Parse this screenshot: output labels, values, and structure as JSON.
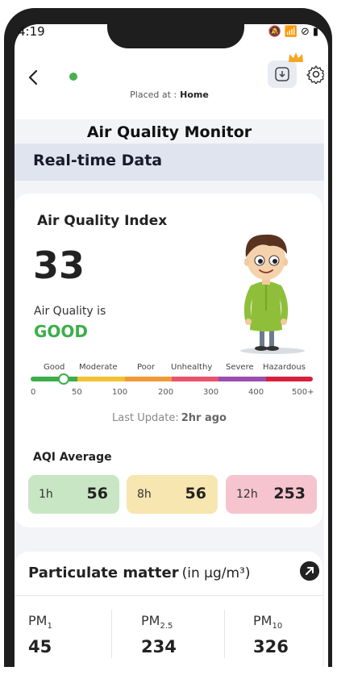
{
  "status_bar": {
    "time": "4:19"
  },
  "header": {
    "placed_at_label": "Placed at :",
    "placed_at_value": "Home",
    "online_color": "#4caf50"
  },
  "page_title": "Air Quality Monitor",
  "section_title": "Real-time Data",
  "aqi": {
    "title": "Air Quality Index",
    "value": "33",
    "quality_label": "Air Quality is",
    "quality_status": "GOOD",
    "marker_value": 33,
    "scale_labels": [
      "Good",
      "Moderate",
      "Poor",
      "Unhealthy",
      "Severe",
      "Hazardous"
    ],
    "scale_colors": [
      "#3cae4c",
      "#f2c232",
      "#f29a3a",
      "#e8536e",
      "#9b4db0",
      "#d6213b"
    ],
    "scale_numbers": [
      "0",
      "50",
      "100",
      "200",
      "300",
      "400",
      "500+"
    ],
    "last_update_label": "Last Update:",
    "last_update_value": "2hr ago"
  },
  "aqi_average": {
    "title": "AQI Average",
    "items": [
      {
        "label": "1h",
        "value": "56",
        "color": "#c8e6c3"
      },
      {
        "label": "8h",
        "value": "56",
        "color": "#f7e6b0"
      },
      {
        "label": "12h",
        "value": "253",
        "color": "#f5c4cf"
      }
    ]
  },
  "particulate": {
    "title": "Particulate matter",
    "unit": "(in µg/m³)",
    "items": [
      {
        "name": "PM",
        "sub": "1",
        "value": "45"
      },
      {
        "name": "PM",
        "sub": "2.5",
        "value": "234"
      },
      {
        "name": "PM",
        "sub": "10",
        "value": "326"
      }
    ]
  }
}
